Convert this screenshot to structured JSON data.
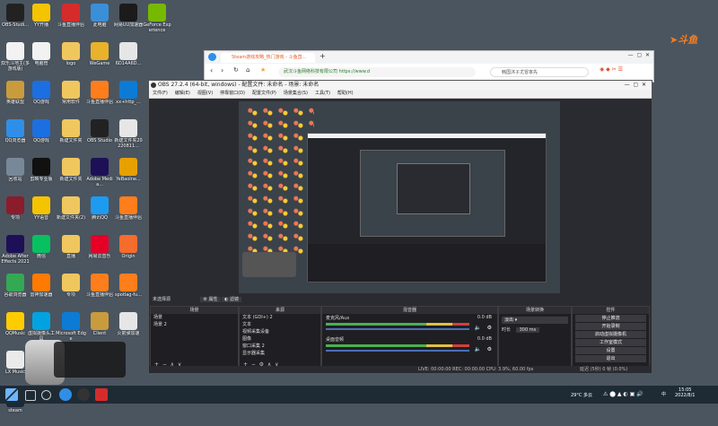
{
  "desktop_columns": [
    [
      {
        "label": "OBS-Studi...",
        "icon": "obs-icon",
        "color": "#222222"
      },
      {
        "label": "双乐斗地主(多游戏版)",
        "icon": "doc-icon",
        "color": "#f2f2f2"
      },
      {
        "label": "英雄联盟",
        "icon": "lol-icon",
        "color": "#c89b3c"
      },
      {
        "label": "QQ浏览器",
        "icon": "qqbrowser-icon",
        "color": "#2f8fe8"
      },
      {
        "label": "回收站",
        "icon": "recycle-icon",
        "color": "#778899"
      },
      {
        "label": "专项",
        "icon": "winrar-icon",
        "color": "#8b1c2b"
      },
      {
        "label": "Adobe After Effects 2021",
        "icon": "ae-icon",
        "color": "#1e1057"
      },
      {
        "label": "谷歌浏览器",
        "icon": "chrome-icon",
        "color": "#34a853"
      },
      {
        "label": "QQMusic",
        "icon": "qqmusic-icon",
        "color": "#ffcc00"
      },
      {
        "label": "LX Music",
        "icon": "lxmusic-icon",
        "color": "#eaeaea"
      },
      {
        "label": "steam",
        "icon": "steam-icon",
        "color": "#1b2838"
      }
    ],
    [
      {
        "label": "YY开播",
        "icon": "yy-icon",
        "color": "#f5c400"
      },
      {
        "label": "电脑管",
        "icon": "doc-icon",
        "color": "#f2f2f2"
      },
      {
        "label": "QQ游戏",
        "icon": "qqgame-icon",
        "color": "#1c6fe0"
      },
      {
        "label": "QQ游戏",
        "icon": "qqgame2-icon",
        "color": "#1c6fe0"
      },
      {
        "label": "剪映专业版",
        "icon": "capcut-icon",
        "color": "#111111"
      },
      {
        "label": "YY语音",
        "icon": "yyvoice-icon",
        "color": "#f5c400"
      },
      {
        "label": "微信",
        "icon": "wechat-icon",
        "color": "#07c160"
      },
      {
        "label": "雷神加速器",
        "icon": "leishen-icon",
        "color": "#ff7a00"
      },
      {
        "label": "虚拟摄像头工具",
        "icon": "vcam-icon",
        "color": "#00a3e0"
      },
      {
        "label": "",
        "icon": "blank-icon",
        "color": "#4b5560"
      }
    ],
    [
      {
        "label": "斗鱼直播伴侣",
        "icon": "douyu-icon",
        "color": "#d62b2b"
      },
      {
        "label": "logo",
        "icon": "folder-icon",
        "color": "#f0c75e"
      },
      {
        "label": "常用软件",
        "icon": "folder-icon",
        "color": "#f0c75e"
      },
      {
        "label": "新建文件夹",
        "icon": "folder-icon",
        "color": "#f0c75e"
      },
      {
        "label": "新建文件夹",
        "icon": "folder-icon",
        "color": "#f0c75e"
      },
      {
        "label": "新建文件夹(2)",
        "icon": "folder-icon",
        "color": "#f0c75e"
      },
      {
        "label": "直播",
        "icon": "folder-icon",
        "color": "#f0c75e"
      },
      {
        "label": "专项",
        "icon": "folder-icon",
        "color": "#f0c75e"
      },
      {
        "label": "Microsoft Edge",
        "icon": "edge-icon",
        "color": "#0c7bd6"
      }
    ],
    [
      {
        "label": "此电脑",
        "icon": "pc-icon",
        "color": "#3a8fd9"
      },
      {
        "label": "WeGame",
        "icon": "wegame-icon",
        "color": "#e8b22a"
      },
      {
        "label": "斗鱼直播伴侣",
        "icon": "douyu2-icon",
        "color": "#ff7e1b"
      },
      {
        "label": "OBS Studio",
        "icon": "obs2-icon",
        "color": "#222222"
      },
      {
        "label": "Adobe Media...",
        "icon": "me-icon",
        "color": "#1e1057"
      },
      {
        "label": "腾讯QQ",
        "icon": "qq-icon",
        "color": "#1d9bf0"
      },
      {
        "label": "网易云音乐",
        "icon": "netease-icon",
        "color": "#e60026"
      },
      {
        "label": "斗鱼直播伴侣",
        "icon": "douyu3-icon",
        "color": "#ff7e1b"
      },
      {
        "label": "Client",
        "icon": "client-icon",
        "color": "#c89b3c"
      }
    ],
    [
      {
        "label": "网易UU加速器",
        "icon": "uu-icon",
        "color": "#1b1b1b"
      },
      {
        "label": "6D14A6D...",
        "icon": "file-icon",
        "color": "#e6e6e6"
      },
      {
        "label": "xx+http_...",
        "icon": "edge2-icon",
        "color": "#0c7bd6"
      },
      {
        "label": "新建文件夹20220811...",
        "icon": "file2-icon",
        "color": "#e6e6e6"
      },
      {
        "label": "YeBaoIne...",
        "icon": "yebao-icon",
        "color": "#e6a000"
      },
      {
        "label": "斗鱼直播伴侣",
        "icon": "douyu4-icon",
        "color": "#ff7e1b"
      },
      {
        "label": "Origin",
        "icon": "origin-icon",
        "color": "#f56c2d"
      },
      {
        "label": "spotlag-fu...",
        "icon": "spot-icon",
        "color": "#ff7e1b"
      },
      {
        "label": "火箭弹加速",
        "icon": "rocket-icon",
        "color": "#e6e6e6"
      }
    ],
    [
      {
        "label": "GeForce Experience",
        "icon": "nvidia-icon",
        "color": "#76b900"
      }
    ]
  ],
  "douyu_logo": "斗鱼",
  "browser": {
    "tab_title": "Steam游戏攻略_热门游戏 - 斗鱼直...",
    "url": "武汉斗鱼网络科技有限公司 https://www.d",
    "search": "韩国沐子尤冒率先"
  },
  "obs": {
    "title": "OBS 27.2.4 (64-bit, windows) - 配置文件: 未命名 - 场景: 未命名",
    "menu": [
      "文件(F)",
      "编辑(E)",
      "视图(V)",
      "停靠窗口(D)",
      "配置文件(P)",
      "场景集合(S)",
      "工具(T)",
      "帮助(H)"
    ],
    "scene_toolbar": [
      "未选择源",
      "属性",
      "滤镜"
    ],
    "docks": {
      "scenes": {
        "title": "场景",
        "items": [
          "场景",
          "场景 2"
        ]
      },
      "sources": {
        "title": "来源",
        "items": [
          "文本 (GDI+) 2",
          "文本",
          "视频采集设备",
          "图像",
          "窗口采集 2",
          "显示器采集"
        ]
      },
      "mixer": {
        "title": "混音器",
        "tracks": [
          {
            "name": "麦克风/Aux",
            "level": "0.0 dB"
          },
          {
            "name": "桌面音频",
            "level": "0.0 dB"
          }
        ]
      },
      "transitions": {
        "title": "场景转换",
        "selected": "淡出",
        "duration_label": "时长",
        "duration": "300 ms"
      },
      "controls": {
        "title": "控件",
        "buttons": [
          "停止推流",
          "开始录制",
          "启动虚拟摄像机",
          "工作室模式",
          "设置",
          "退出"
        ]
      }
    },
    "status": "LIVE: 00:00:00   REC: 00:00:00   CPU: 3.9%, 60.00 fps",
    "status_right": "延迟 (5秒) 0 帧 (0.0%)"
  },
  "taskbar": {
    "weather": "29°C 多云",
    "lang": "中",
    "time": "15:05",
    "date": "2022/8/1"
  }
}
